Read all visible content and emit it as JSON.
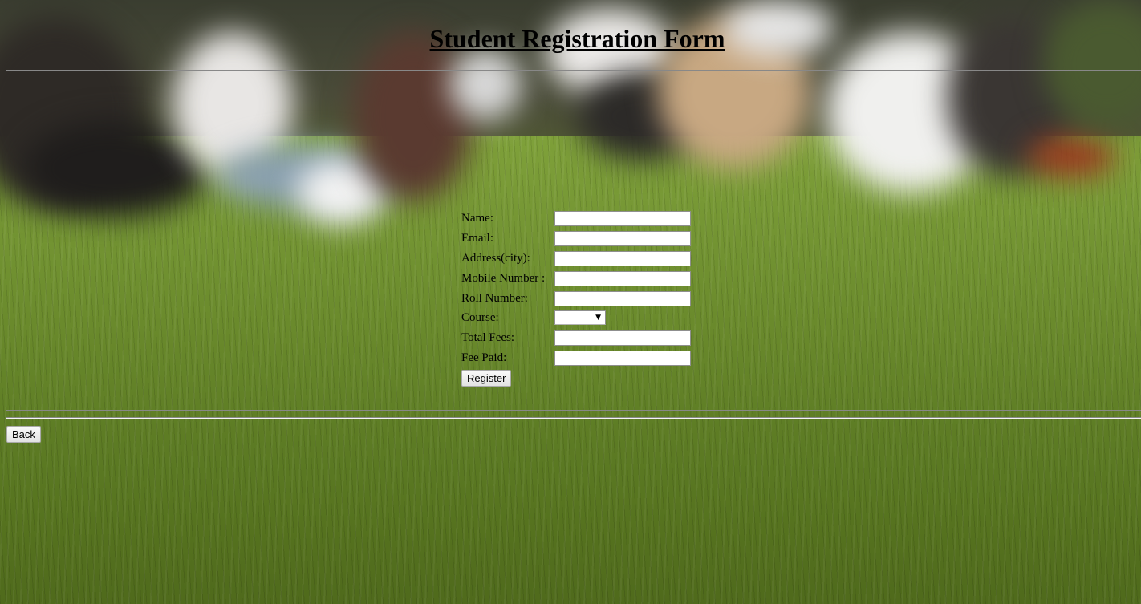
{
  "page": {
    "title": "Student Registration Form"
  },
  "form": {
    "fields": [
      {
        "label": "Name:",
        "value": ""
      },
      {
        "label": "Email:",
        "value": ""
      },
      {
        "label": "Address(city):",
        "value": ""
      },
      {
        "label": "Mobile Number :",
        "value": ""
      },
      {
        "label": "Roll Number:",
        "value": ""
      }
    ],
    "course": {
      "label": "Course:",
      "selected": "",
      "arrow": "▼"
    },
    "fee_fields": [
      {
        "label": "Total Fees:",
        "value": ""
      },
      {
        "label": "Fee Paid:",
        "value": ""
      }
    ],
    "register_label": "Register"
  },
  "footer": {
    "back_label": "Back"
  }
}
